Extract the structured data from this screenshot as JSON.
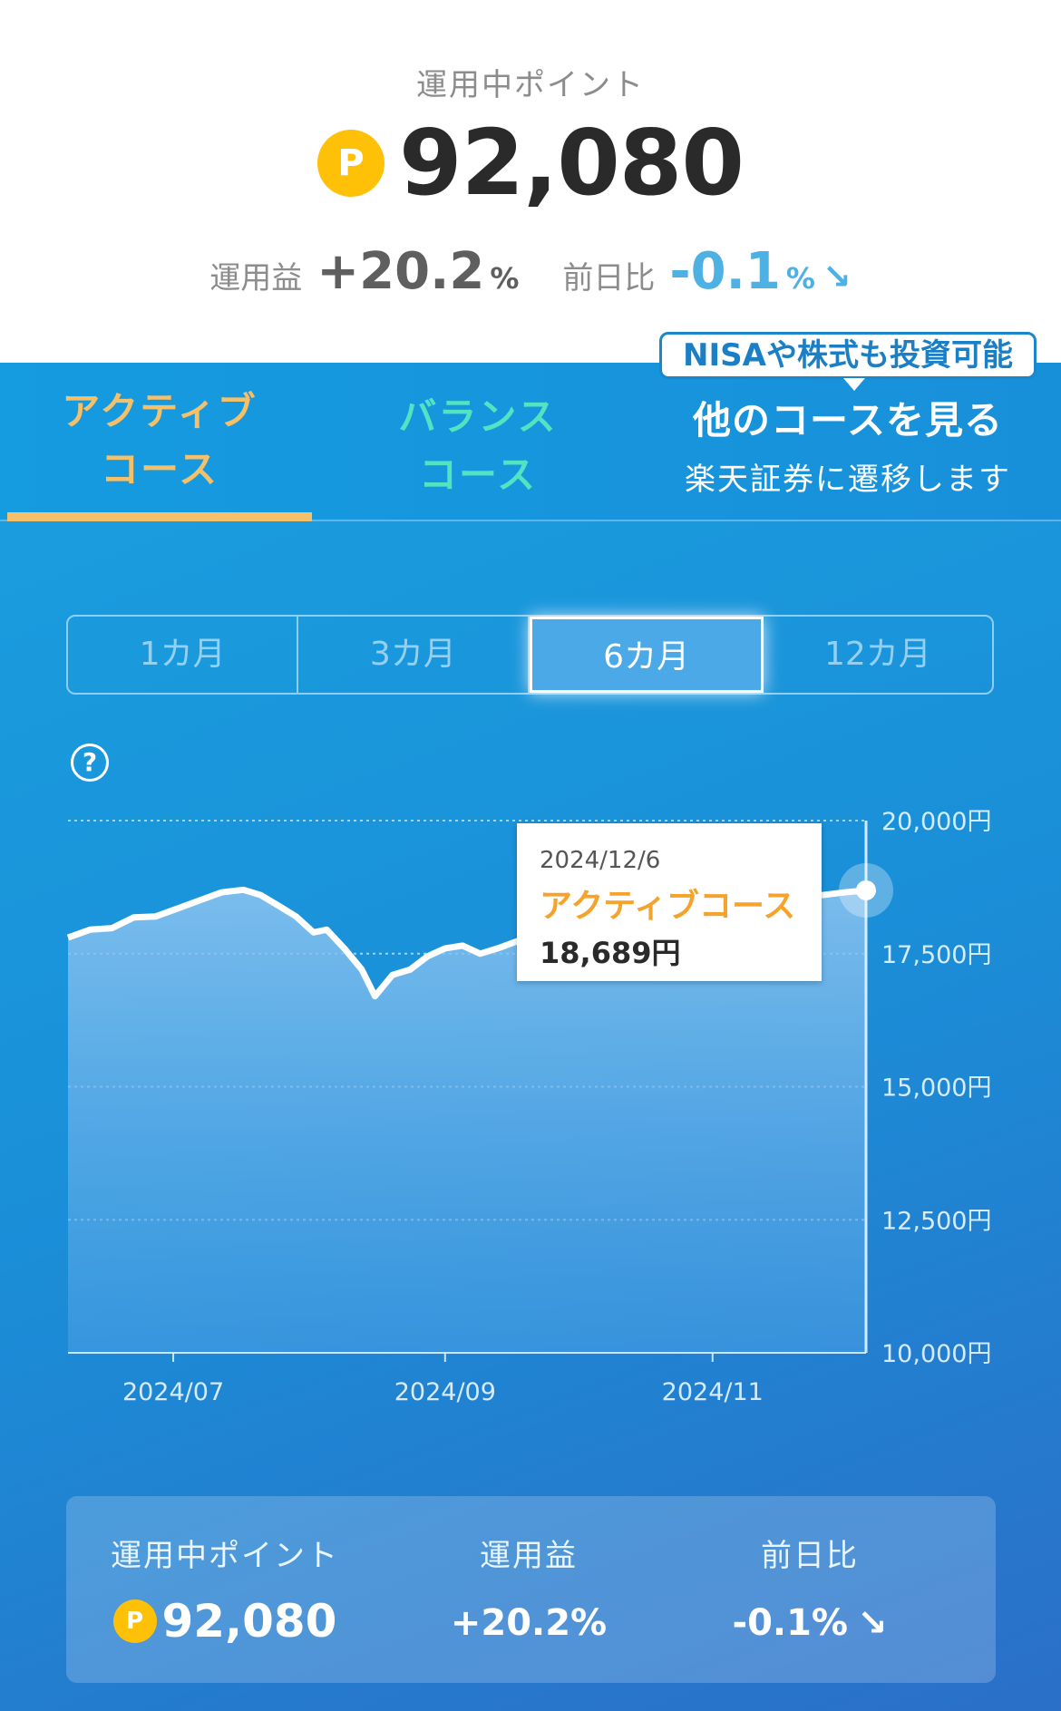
{
  "header": {
    "label": "運用中ポイント",
    "coin": "P",
    "points": "92,080",
    "profit_label": "運用益",
    "profit_value": "+20.2",
    "profit_unit": "%",
    "daychange_label": "前日比",
    "daychange_value": "-0.1",
    "daychange_unit": "%",
    "daychange_arrow": "↘"
  },
  "tabs": {
    "active": {
      "line1": "アクティブ",
      "line2": "コース"
    },
    "balance": {
      "line1": "バランス",
      "line2": "コース"
    },
    "other": {
      "badge": "NISAや株式も投資可能",
      "title": "他のコースを見る",
      "subtitle": "楽天証券に遷移します"
    }
  },
  "periods": [
    "1カ月",
    "3カ月",
    "6カ月",
    "12カ月"
  ],
  "selected_period": 2,
  "help_icon": "?",
  "tooltip": {
    "date": "2024/12/6",
    "name": "アクティブコース",
    "value": "18,689円"
  },
  "summary": {
    "points_label": "運用中ポイント",
    "coin": "P",
    "points_value": "92,080",
    "profit_label": "運用益",
    "profit_value": "+20.2%",
    "daychange_label": "前日比",
    "daychange_value": "-0.1%",
    "daychange_arrow": "↘"
  },
  "colors": {
    "active_tab": "#f4c06a",
    "balance_tab": "#52e3c2",
    "coin": "#ffc107",
    "negative": "#4eb1e4",
    "tooltip_name": "#f5a32c"
  },
  "chart_data": {
    "type": "area",
    "y_ticks": [
      "20,000円",
      "17,500円",
      "15,000円",
      "12,500円",
      "10,000円"
    ],
    "y_tick_values": [
      20000,
      17500,
      15000,
      12500,
      10000
    ],
    "x_ticks": [
      "2024/07",
      "2024/09",
      "2024/11"
    ],
    "x_tick_values": [
      "2024-07-01",
      "2024-09-01",
      "2024-11-01"
    ],
    "ylim": [
      10000,
      20000
    ],
    "xlim": [
      "2024-06-07",
      "2024-12-06"
    ],
    "series": [
      {
        "points": [
          [
            "2024-06-07",
            17800
          ],
          [
            "2024-06-12",
            17950
          ],
          [
            "2024-06-17",
            17980
          ],
          [
            "2024-06-22",
            18180
          ],
          [
            "2024-06-27",
            18200
          ],
          [
            "2024-07-02",
            18350
          ],
          [
            "2024-07-07",
            18500
          ],
          [
            "2024-07-12",
            18650
          ],
          [
            "2024-07-17",
            18700
          ],
          [
            "2024-07-21",
            18600
          ],
          [
            "2024-07-25",
            18400
          ],
          [
            "2024-07-29",
            18200
          ],
          [
            "2024-08-02",
            17900
          ],
          [
            "2024-08-05",
            17950
          ],
          [
            "2024-08-09",
            17600
          ],
          [
            "2024-08-13",
            17200
          ],
          [
            "2024-08-16",
            16700
          ],
          [
            "2024-08-20",
            17100
          ],
          [
            "2024-08-24",
            17200
          ],
          [
            "2024-08-28",
            17450
          ],
          [
            "2024-09-01",
            17600
          ],
          [
            "2024-09-05",
            17650
          ],
          [
            "2024-09-09",
            17500
          ],
          [
            "2024-09-13",
            17600
          ],
          [
            "2024-09-18",
            17750
          ],
          [
            "2024-09-22",
            17500
          ],
          [
            "2024-09-26",
            17300
          ],
          [
            "2024-09-30",
            17050
          ],
          [
            "2024-10-04",
            17200
          ],
          [
            "2024-10-08",
            17300
          ],
          [
            "2024-10-12",
            17450
          ],
          [
            "2024-10-16",
            17550
          ],
          [
            "2024-10-20",
            17700
          ],
          [
            "2024-10-24",
            17850
          ],
          [
            "2024-10-28",
            18000
          ],
          [
            "2024-11-01",
            18100
          ],
          [
            "2024-11-06",
            18250
          ],
          [
            "2024-11-11",
            18350
          ],
          [
            "2024-11-16",
            18450
          ],
          [
            "2024-11-21",
            18550
          ],
          [
            "2024-11-26",
            18600
          ],
          [
            "2024-12-01",
            18650
          ],
          [
            "2024-12-06",
            18689
          ]
        ]
      }
    ],
    "highlight": [
      "2024-12-06",
      18689
    ],
    "grid": true
  }
}
